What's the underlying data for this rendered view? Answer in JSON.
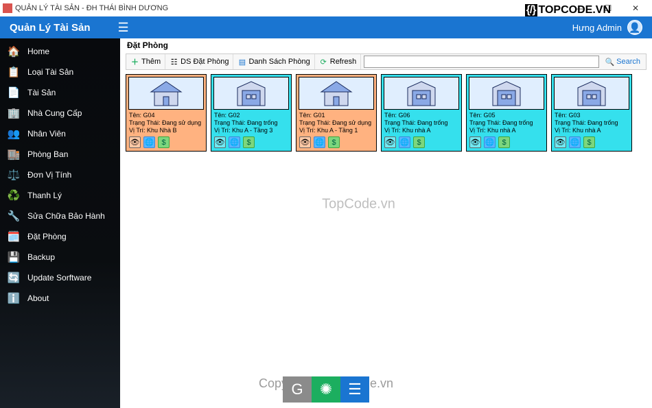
{
  "window": {
    "title": "QUẢN LÝ TÀI SẢN - ĐH THÁI BÌNH DƯƠNG"
  },
  "watermark": {
    "brand": "TOPCODE.VN",
    "center": "TopCode.vn",
    "bottom": "Copyright © TopCode.vn"
  },
  "header": {
    "brand": "Quản Lý Tài Sản",
    "user": "Hưng Admin"
  },
  "sidebar": {
    "items": [
      {
        "icon": "🏠",
        "label": "Home"
      },
      {
        "icon": "📋",
        "label": "Loại Tài Sản"
      },
      {
        "icon": "📄",
        "label": "Tài Sản"
      },
      {
        "icon": "🏢",
        "label": "Nhà Cung Cấp"
      },
      {
        "icon": "👥",
        "label": "Nhân Viên"
      },
      {
        "icon": "🏬",
        "label": "Phòng Ban"
      },
      {
        "icon": "⚖️",
        "label": "Đơn Vị Tính"
      },
      {
        "icon": "♻️",
        "label": "Thanh Lý"
      },
      {
        "icon": "🔧",
        "label": "Sửa Chữa Bảo Hành"
      },
      {
        "icon": "🗓️",
        "label": "Đặt Phòng"
      },
      {
        "icon": "💾",
        "label": "Backup"
      },
      {
        "icon": "🔄",
        "label": "Update Sorftware"
      },
      {
        "icon": "ℹ️",
        "label": "About"
      }
    ]
  },
  "content": {
    "title": "Đặt Phòng",
    "toolbar": {
      "add": "Thêm",
      "list_booking": "DS Đặt Phòng",
      "room_list": "Danh Sách Phòng",
      "refresh": "Refresh",
      "search_placeholder": "",
      "search_btn": "Search"
    },
    "rooms": [
      {
        "name": "Tên: G04",
        "status": "Trạng Thái: Đang sử dụng",
        "location": "Vị Trí: Khu Nhà B",
        "state": "orange",
        "shape": "house"
      },
      {
        "name": "Tên: G02",
        "status": "Trạng Thái: Đang trống",
        "location": "Vị Trí: Khu A - Tầng 3",
        "state": "cyan",
        "shape": "warehouse"
      },
      {
        "name": "Tên: G01",
        "status": "Trạng Thái: Đang sử dụng",
        "location": "Vị Trí: Khu A - Tầng 1",
        "state": "orange",
        "shape": "house"
      },
      {
        "name": "Tên: G06",
        "status": "Trạng Thái: Đang trống",
        "location": "Vị Trí: Khu nhà A",
        "state": "cyan",
        "shape": "warehouse"
      },
      {
        "name": "Tên: G05",
        "status": "Trạng Thái: Đang trống",
        "location": "Vị Trí: Khu nhà A",
        "state": "cyan",
        "shape": "warehouse"
      },
      {
        "name": "Tên: G03",
        "status": "Trạng Thái: Đang trống",
        "location": "Vị Trí: Khu nhà A",
        "state": "cyan",
        "shape": "warehouse"
      }
    ]
  }
}
